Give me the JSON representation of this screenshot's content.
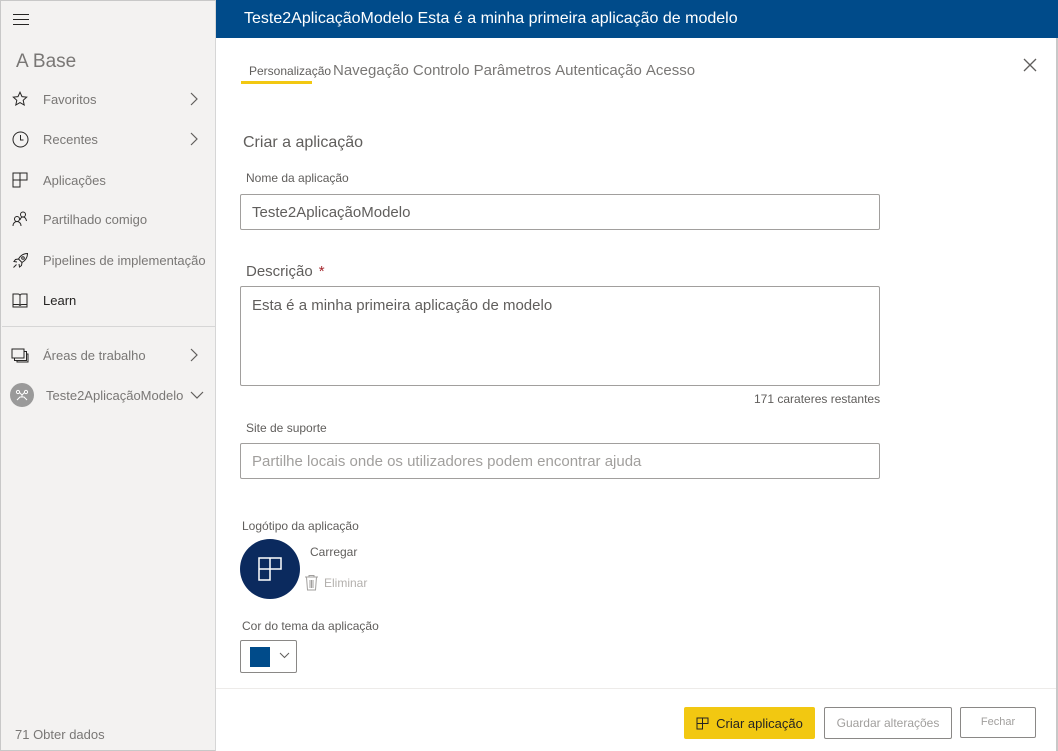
{
  "sidebar": {
    "home_title": "A Base",
    "items": [
      {
        "label": "Favoritos",
        "icon": "star-icon",
        "has_chevron": true
      },
      {
        "label": "Recentes",
        "icon": "clock-icon",
        "has_chevron": true
      },
      {
        "label": "Aplicações",
        "icon": "apps-icon",
        "has_chevron": false
      },
      {
        "label": "Partilhado comigo",
        "icon": "shared-icon",
        "has_chevron": false
      },
      {
        "label": "Pipelines de implementação",
        "icon": "rocket-icon",
        "has_chevron": false
      },
      {
        "label": "Learn",
        "icon": "book-icon",
        "has_chevron": false
      },
      {
        "label": "Áreas de trabalho",
        "icon": "workspaces-icon",
        "has_chevron": true
      },
      {
        "label": "Teste2AplicaçãoModelo",
        "icon": "workspace-avatar",
        "has_chevron": true
      }
    ],
    "get_data": "71 Obter dados"
  },
  "header": {
    "title": "Teste2AplicaçãoModelo Esta é a minha primeira aplicação de modelo"
  },
  "tabs": [
    {
      "label": "Personalização",
      "active": true
    },
    {
      "label": "Navegação",
      "active": false
    },
    {
      "label": "Controlo",
      "active": false
    },
    {
      "label": "Parâmetros",
      "active": false
    },
    {
      "label": "Autenticação",
      "active": false
    },
    {
      "label": "Acesso",
      "active": false
    }
  ],
  "form": {
    "section_title": "Criar a aplicação",
    "app_name": {
      "label": "Nome da aplicação",
      "value": "Teste2AplicaçãoModelo"
    },
    "description": {
      "label": "Descrição",
      "required_mark": "*",
      "value": "Esta é a minha primeira aplicação de modelo",
      "counter": "171 carateres restantes"
    },
    "support_site": {
      "label": "Site de suporte",
      "value": "",
      "placeholder": "Partilhe locais onde os utilizadores podem encontrar ajuda"
    },
    "logo": {
      "label": "Logótipo da aplicação",
      "upload": "Carregar",
      "delete": "Eliminar"
    },
    "theme_color": {
      "label": "Cor do tema da aplicação",
      "value": "#004b8a"
    }
  },
  "footer": {
    "create_label": "Criar aplicação",
    "save_label": "Guardar alterações",
    "close_label": "Fechar"
  },
  "colors": {
    "header_bg": "#004b8a",
    "accent": "#f2c811",
    "logo_bg": "#0b2a5e"
  }
}
